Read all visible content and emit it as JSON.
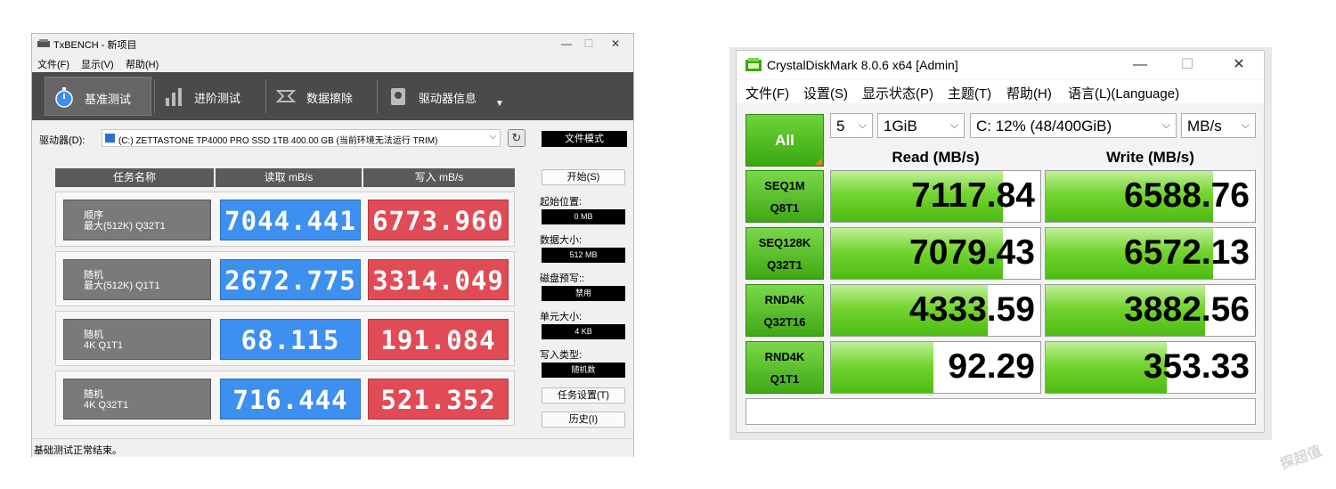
{
  "txbench": {
    "title": "TxBENCH - 新项目",
    "window_controls": {
      "minimize": "—",
      "maximize": "☐",
      "close": "✕"
    },
    "menu": [
      "文件(F)",
      "显示(V)",
      "帮助(H)"
    ],
    "tabs": [
      "基准测试",
      "进阶测试",
      "数据擦除",
      "驱动器信息"
    ],
    "drive_label": "驱动器(D):",
    "drive_value": "(C:) ZETTASTONE TP4000 PRO SSD 1TB  400.00 GB (当前环境无法运行 TRIM)",
    "mode_button": "文件模式",
    "headers": {
      "task": "任务名称",
      "read": "读取 mB/s",
      "write": "写入 mB/s"
    },
    "rows": [
      {
        "line1": "顺序",
        "line2": "最大(512K) Q32T1",
        "read": "7044.441",
        "write": "6773.960"
      },
      {
        "line1": "随机",
        "line2": "最大(512K) Q1T1",
        "read": "2672.775",
        "write": "3314.049"
      },
      {
        "line1": "随机",
        "line2": "4K Q1T1",
        "read": "68.115",
        "write": "191.084"
      },
      {
        "line1": "随机",
        "line2": "4K Q32T1",
        "read": "716.444",
        "write": "521.352"
      }
    ],
    "side": {
      "start_button": "开始(S)",
      "start_pos_label": "起始位置:",
      "start_pos_value": "0 MB",
      "data_size_label": "数据大小:",
      "data_size_value": "512 MB",
      "prewrite_label": "磁盘预写::",
      "prewrite_value": "禁用",
      "unit_size_label": "单元大小:",
      "unit_size_value": "4 KB",
      "write_type_label": "写入类型:",
      "write_type_value": "随机数",
      "task_settings_button": "任务设置(T)",
      "history_button": "历史(I)"
    },
    "status": "基础测试正常结束。"
  },
  "cdm": {
    "title": "CrystalDiskMark 8.0.6 x64 [Admin]",
    "window_controls": {
      "minimize": "—",
      "maximize": "☐",
      "close": "✕"
    },
    "menu": [
      "文件(F)",
      "设置(S)",
      "显示状态(P)",
      "主题(T)",
      "帮助(H)",
      "语言(L)(Language)"
    ],
    "all_button": "All",
    "count": "5",
    "size": "1GiB",
    "drive": "C: 12% (48/400GiB)",
    "unit": "MB/s",
    "read_header": "Read (MB/s)",
    "write_header": "Write (MB/s)",
    "rows": [
      {
        "l1": "SEQ1M",
        "l2": "Q8T1",
        "read": "7117.84",
        "write": "6588.76",
        "read_fill": 0.82,
        "write_fill": 0.8
      },
      {
        "l1": "SEQ128K",
        "l2": "Q32T1",
        "read": "7079.43",
        "write": "6572.13",
        "read_fill": 0.82,
        "write_fill": 0.8
      },
      {
        "l1": "RND4K",
        "l2": "Q32T16",
        "read": "4333.59",
        "write": "3882.56",
        "read_fill": 0.75,
        "write_fill": 0.76
      },
      {
        "l1": "RND4K",
        "l2": "Q1T1",
        "read": "92.29",
        "write": "353.33",
        "read_fill": 0.49,
        "write_fill": 0.58
      }
    ],
    "comment": ""
  },
  "watermark": "探超值"
}
